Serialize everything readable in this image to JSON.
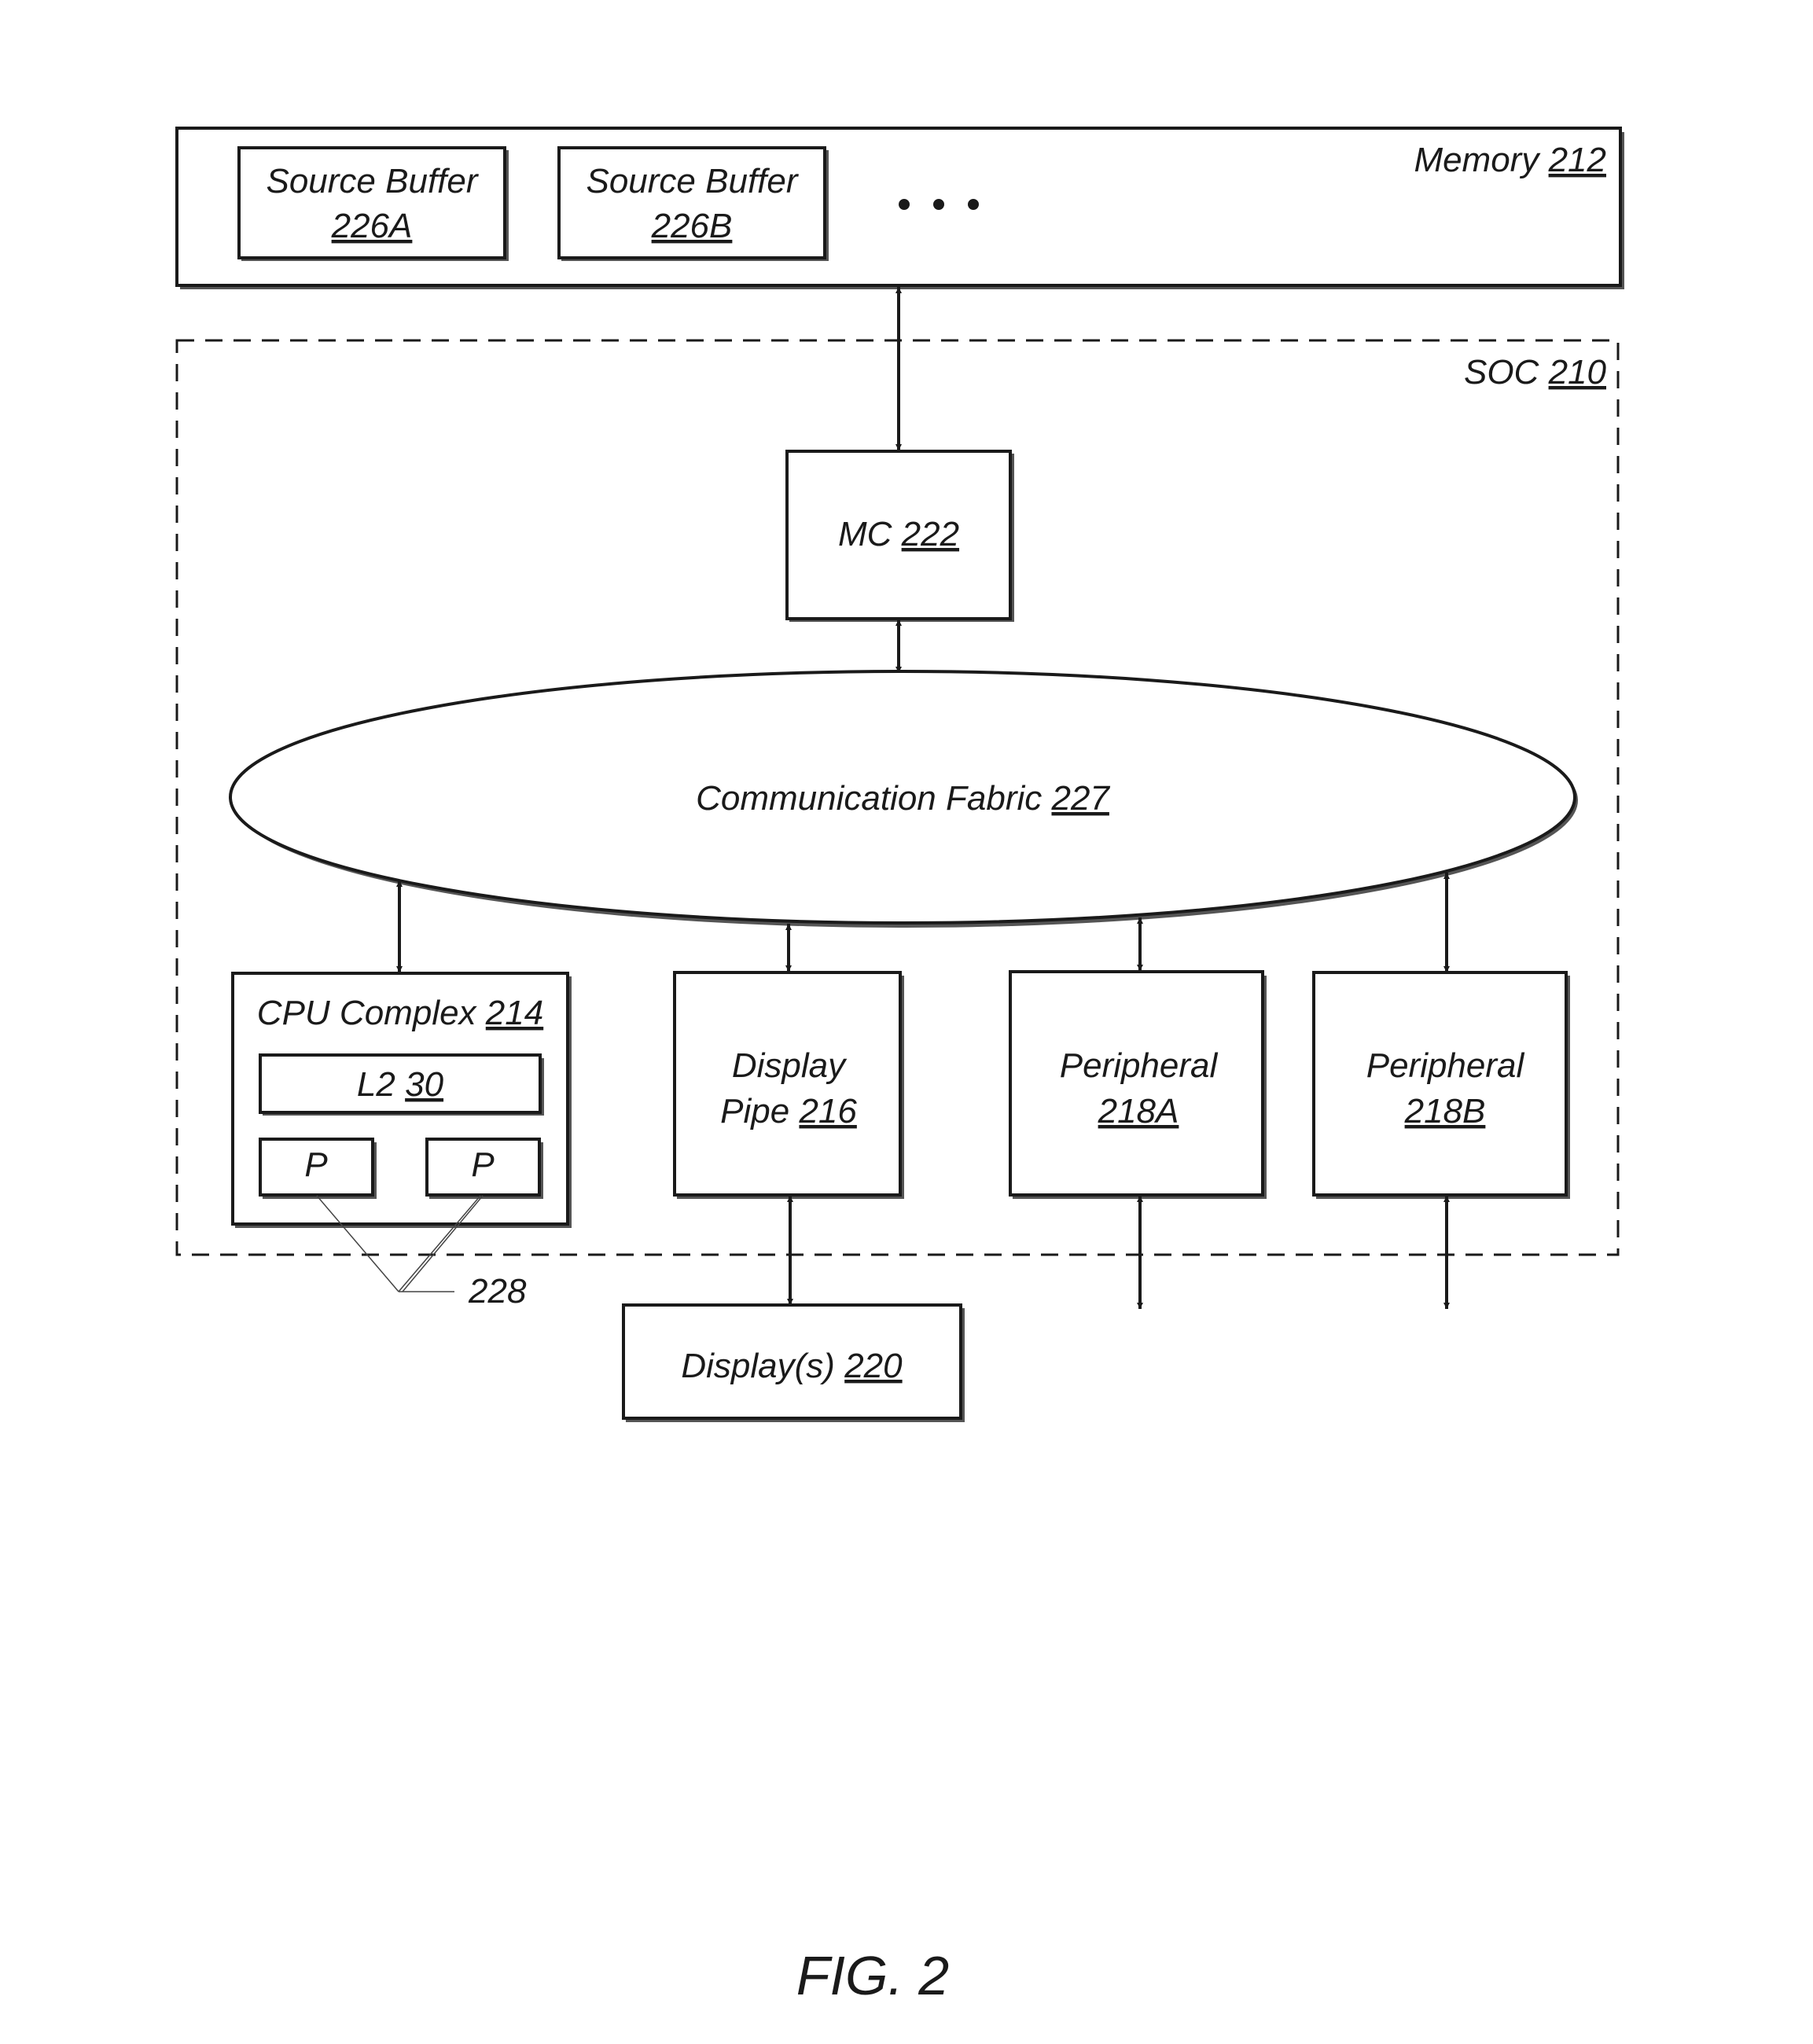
{
  "figure": {
    "caption": "FIG. 2"
  },
  "memory": {
    "name": "Memory",
    "ref": "212",
    "buffers": [
      {
        "name": "Source Buffer",
        "ref": "226A"
      },
      {
        "name": "Source Buffer",
        "ref": "226B"
      }
    ],
    "ellipsis": "• • •"
  },
  "soc": {
    "name": "SOC",
    "ref": "210",
    "mc": {
      "name": "MC",
      "ref": "222"
    },
    "fabric": {
      "name": "Communication Fabric",
      "ref": "227"
    },
    "cpu": {
      "name": "CPU Complex",
      "ref": "214",
      "l2": {
        "name": "L2",
        "ref": "30"
      },
      "processors": [
        {
          "name": "P"
        },
        {
          "name": "P"
        }
      ],
      "processor_ref": "228"
    },
    "display_pipe": {
      "line1": "Display",
      "line2": "Pipe",
      "ref": "216"
    },
    "peripherals": [
      {
        "name": "Peripheral",
        "ref": "218A"
      },
      {
        "name": "Peripheral",
        "ref": "218B"
      }
    ]
  },
  "displays": {
    "name": "Display(s)",
    "ref": "220"
  }
}
